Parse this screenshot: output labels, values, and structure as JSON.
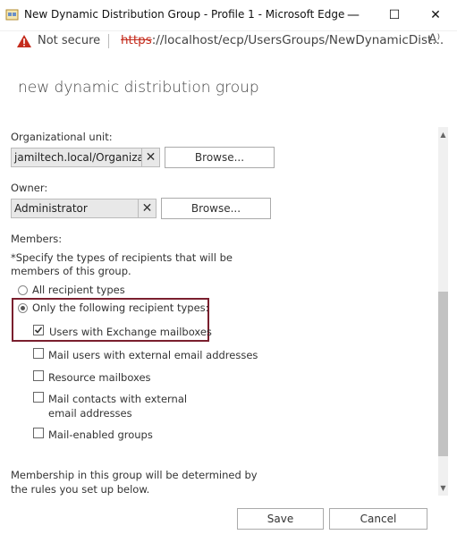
{
  "window": {
    "title": "New Dynamic Distribution Group - Profile 1 - Microsoft Edge",
    "minimize": "—",
    "maximize": "☐",
    "close": "✕"
  },
  "address": {
    "security": "Not secure",
    "scheme": "https",
    "rest": "://localhost/ecp/UsersGroups/NewDynamicDist...",
    "read_aloud": "A⁾"
  },
  "dialog": {
    "title": "new dynamic distribution group",
    "ou_label": "Organizational unit:",
    "ou_value": "jamiltech.local/Organizatio",
    "ou_browse": "Browse...",
    "owner_label": "Owner:",
    "owner_value": "Administrator",
    "owner_browse": "Browse...",
    "members_label": "Members:",
    "specify_text": "*Specify the types of recipients that will be members of this group.",
    "radio_all": "All recipient types",
    "radio_following": "Only the following recipient types:",
    "checkboxes": [
      {
        "label": "Users with Exchange mailboxes",
        "checked": true
      },
      {
        "label": "Mail users with external email addresses",
        "checked": false
      },
      {
        "label": "Resource mailboxes",
        "checked": false
      },
      {
        "label": "Mail contacts with external email addresses",
        "checked": false
      },
      {
        "label": "Mail-enabled groups",
        "checked": false
      }
    ],
    "membership_note": "Membership in this group will be determined by the rules you set up below.",
    "save": "Save",
    "cancel": "Cancel"
  },
  "colors": {
    "highlight": "#7a1f2e",
    "warning": "#c42b1c"
  }
}
